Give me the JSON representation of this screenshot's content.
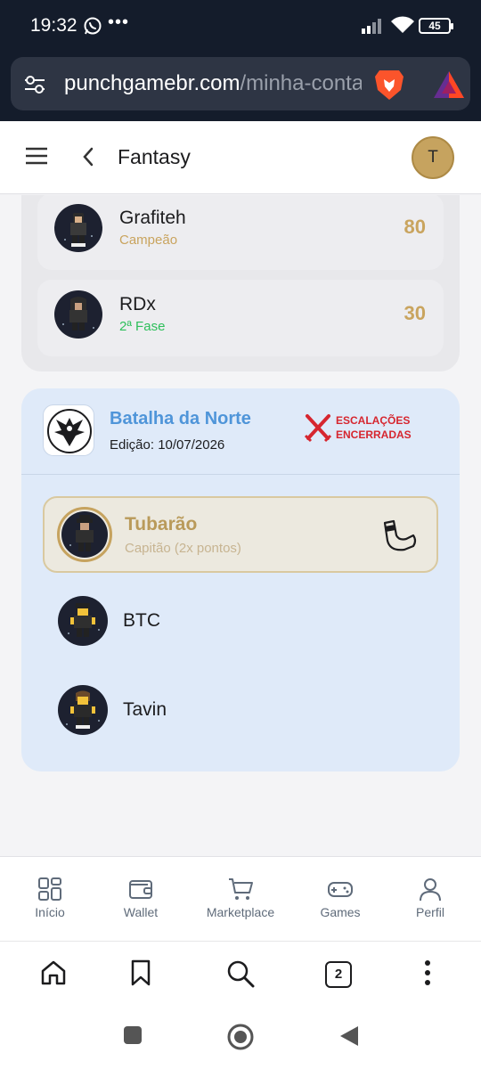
{
  "status_bar": {
    "time": "19:32",
    "battery": "45"
  },
  "browser": {
    "url_domain": "punchgamebr.com",
    "url_path": "/minha-conta",
    "tab_count": "2"
  },
  "header": {
    "title": "Fantasy",
    "avatar_initial": "T"
  },
  "ranking": [
    {
      "name": "Grafiteh",
      "status": "Campeão",
      "score": "80"
    },
    {
      "name": "RDx",
      "status": "2ª Fase",
      "score": "30"
    }
  ],
  "league": {
    "name": "Batalha da Norte",
    "edition": "Edição: 10/07/2026",
    "status_line1": "ESCALAÇÕES",
    "status_line2": "ENCERRADAS",
    "squad": [
      {
        "name": "Tubarão",
        "role": "Capitão (2x pontos)"
      },
      {
        "name": "BTC"
      },
      {
        "name": "Tavin"
      }
    ]
  },
  "bottom_nav": [
    "Início",
    "Wallet",
    "Marketplace",
    "Games",
    "Perfil"
  ],
  "colors": {
    "gold": "#c9a45e",
    "league_blue": "#4f95d9",
    "closed_red": "#d6262f",
    "phase_green": "#2dbf5a"
  }
}
